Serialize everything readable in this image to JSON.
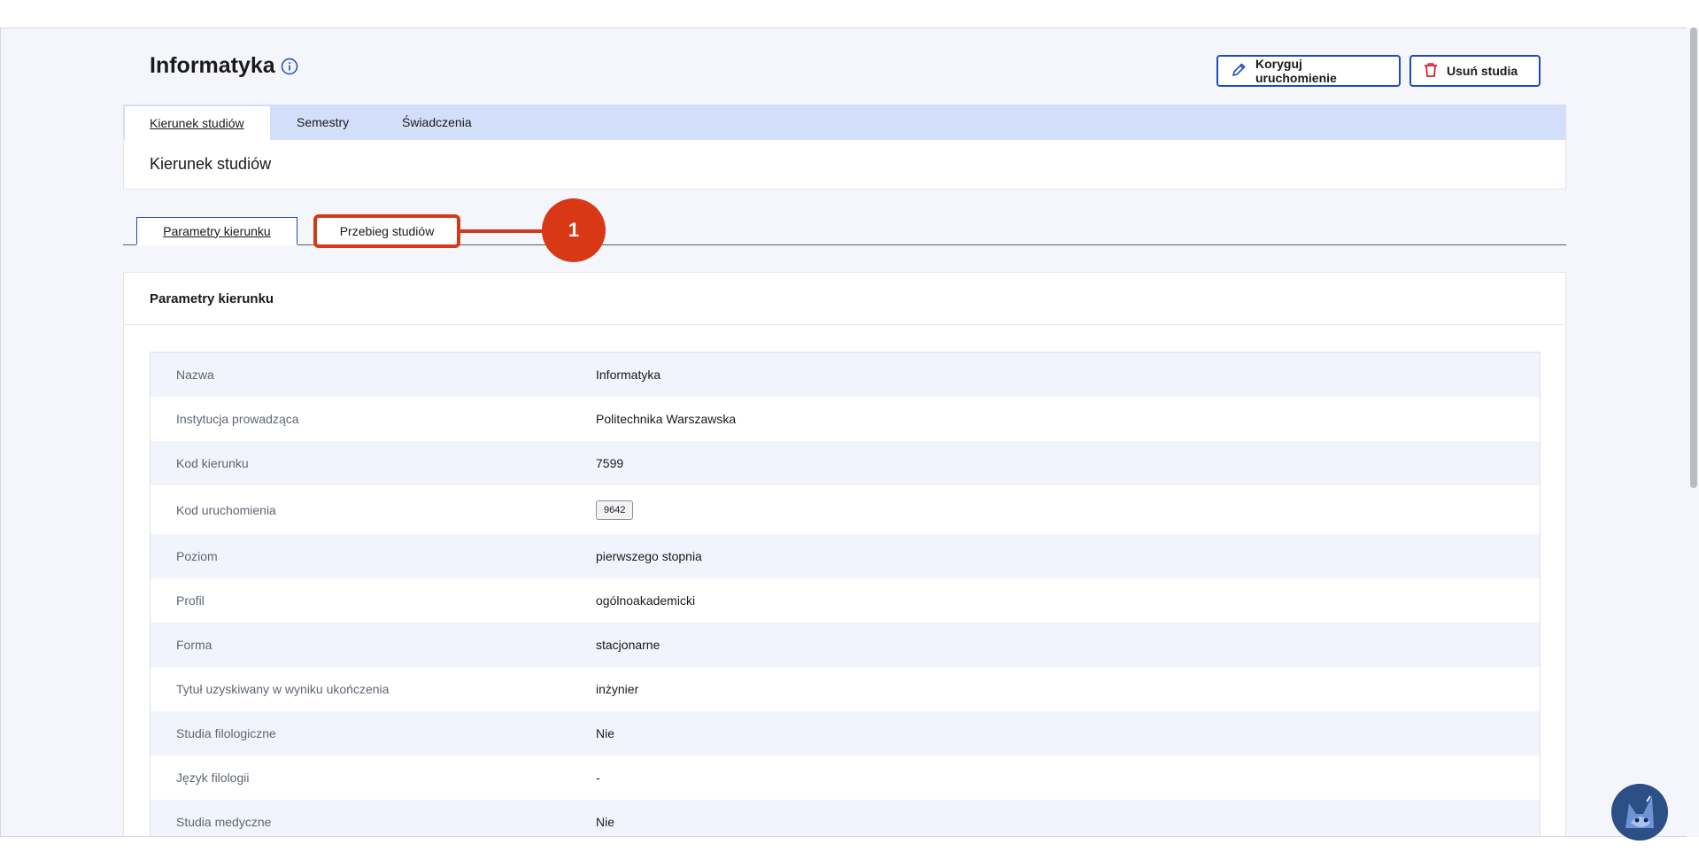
{
  "page": {
    "title": "Informatyka"
  },
  "actions": {
    "edit_label": "Koryguj uruchomienie",
    "delete_label": "Usuń studia"
  },
  "main_tabs": [
    {
      "label": "Kierunek studiów",
      "active": true
    },
    {
      "label": "Semestry",
      "active": false
    },
    {
      "label": "Świadczenia",
      "active": false
    }
  ],
  "section": {
    "title": "Kierunek studiów"
  },
  "sub_tabs": [
    {
      "label": "Parametry kierunku",
      "active": true
    },
    {
      "label": "Przebieg studiów",
      "active": false
    }
  ],
  "callout": {
    "number": "1"
  },
  "card": {
    "title": "Parametry kierunku"
  },
  "params": [
    {
      "label": "Nazwa",
      "value": "Informatyka"
    },
    {
      "label": "Instytucja prowadząca",
      "value": "Politechnika Warszawska"
    },
    {
      "label": "Kod kierunku",
      "value": "7599"
    },
    {
      "label": "Kod uruchomienia",
      "value": "9642"
    },
    {
      "label": "Poziom",
      "value": "pierwszego stopnia"
    },
    {
      "label": "Profil",
      "value": "ogólnoakademicki"
    },
    {
      "label": "Forma",
      "value": "stacjonarne"
    },
    {
      "label": "Tytuł uzyskiwany w wyniku ukończenia",
      "value": "inżynier"
    },
    {
      "label": "Studia filologiczne",
      "value": "Nie"
    },
    {
      "label": "Język filologii",
      "value": "-"
    },
    {
      "label": "Studia medyczne",
      "value": "Nie"
    }
  ],
  "icons": {
    "info": "info-icon",
    "edit": "pencil-icon",
    "delete": "trash-icon"
  },
  "colors": {
    "accent": "#1f4ab8",
    "tab_bar": "#d3defb",
    "highlight": "#d23a1a",
    "delete": "#d5232f"
  }
}
